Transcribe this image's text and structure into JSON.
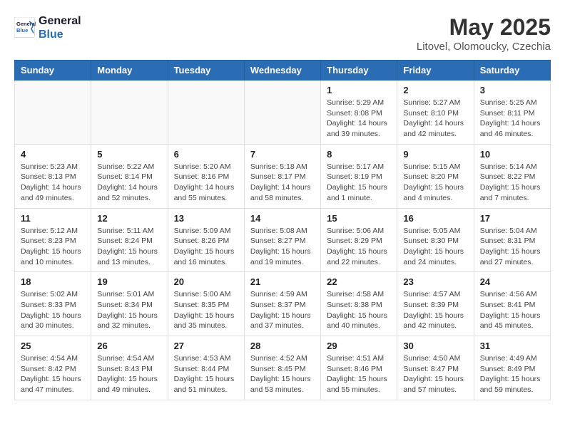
{
  "header": {
    "logo_general": "General",
    "logo_blue": "Blue",
    "month": "May 2025",
    "location": "Litovel, Olomoucky, Czechia"
  },
  "days_of_week": [
    "Sunday",
    "Monday",
    "Tuesday",
    "Wednesday",
    "Thursday",
    "Friday",
    "Saturday"
  ],
  "weeks": [
    [
      {
        "day": "",
        "info": ""
      },
      {
        "day": "",
        "info": ""
      },
      {
        "day": "",
        "info": ""
      },
      {
        "day": "",
        "info": ""
      },
      {
        "day": "1",
        "info": "Sunrise: 5:29 AM\nSunset: 8:08 PM\nDaylight: 14 hours\nand 39 minutes."
      },
      {
        "day": "2",
        "info": "Sunrise: 5:27 AM\nSunset: 8:10 PM\nDaylight: 14 hours\nand 42 minutes."
      },
      {
        "day": "3",
        "info": "Sunrise: 5:25 AM\nSunset: 8:11 PM\nDaylight: 14 hours\nand 46 minutes."
      }
    ],
    [
      {
        "day": "4",
        "info": "Sunrise: 5:23 AM\nSunset: 8:13 PM\nDaylight: 14 hours\nand 49 minutes."
      },
      {
        "day": "5",
        "info": "Sunrise: 5:22 AM\nSunset: 8:14 PM\nDaylight: 14 hours\nand 52 minutes."
      },
      {
        "day": "6",
        "info": "Sunrise: 5:20 AM\nSunset: 8:16 PM\nDaylight: 14 hours\nand 55 minutes."
      },
      {
        "day": "7",
        "info": "Sunrise: 5:18 AM\nSunset: 8:17 PM\nDaylight: 14 hours\nand 58 minutes."
      },
      {
        "day": "8",
        "info": "Sunrise: 5:17 AM\nSunset: 8:19 PM\nDaylight: 15 hours\nand 1 minute."
      },
      {
        "day": "9",
        "info": "Sunrise: 5:15 AM\nSunset: 8:20 PM\nDaylight: 15 hours\nand 4 minutes."
      },
      {
        "day": "10",
        "info": "Sunrise: 5:14 AM\nSunset: 8:22 PM\nDaylight: 15 hours\nand 7 minutes."
      }
    ],
    [
      {
        "day": "11",
        "info": "Sunrise: 5:12 AM\nSunset: 8:23 PM\nDaylight: 15 hours\nand 10 minutes."
      },
      {
        "day": "12",
        "info": "Sunrise: 5:11 AM\nSunset: 8:24 PM\nDaylight: 15 hours\nand 13 minutes."
      },
      {
        "day": "13",
        "info": "Sunrise: 5:09 AM\nSunset: 8:26 PM\nDaylight: 15 hours\nand 16 minutes."
      },
      {
        "day": "14",
        "info": "Sunrise: 5:08 AM\nSunset: 8:27 PM\nDaylight: 15 hours\nand 19 minutes."
      },
      {
        "day": "15",
        "info": "Sunrise: 5:06 AM\nSunset: 8:29 PM\nDaylight: 15 hours\nand 22 minutes."
      },
      {
        "day": "16",
        "info": "Sunrise: 5:05 AM\nSunset: 8:30 PM\nDaylight: 15 hours\nand 24 minutes."
      },
      {
        "day": "17",
        "info": "Sunrise: 5:04 AM\nSunset: 8:31 PM\nDaylight: 15 hours\nand 27 minutes."
      }
    ],
    [
      {
        "day": "18",
        "info": "Sunrise: 5:02 AM\nSunset: 8:33 PM\nDaylight: 15 hours\nand 30 minutes."
      },
      {
        "day": "19",
        "info": "Sunrise: 5:01 AM\nSunset: 8:34 PM\nDaylight: 15 hours\nand 32 minutes."
      },
      {
        "day": "20",
        "info": "Sunrise: 5:00 AM\nSunset: 8:35 PM\nDaylight: 15 hours\nand 35 minutes."
      },
      {
        "day": "21",
        "info": "Sunrise: 4:59 AM\nSunset: 8:37 PM\nDaylight: 15 hours\nand 37 minutes."
      },
      {
        "day": "22",
        "info": "Sunrise: 4:58 AM\nSunset: 8:38 PM\nDaylight: 15 hours\nand 40 minutes."
      },
      {
        "day": "23",
        "info": "Sunrise: 4:57 AM\nSunset: 8:39 PM\nDaylight: 15 hours\nand 42 minutes."
      },
      {
        "day": "24",
        "info": "Sunrise: 4:56 AM\nSunset: 8:41 PM\nDaylight: 15 hours\nand 45 minutes."
      }
    ],
    [
      {
        "day": "25",
        "info": "Sunrise: 4:54 AM\nSunset: 8:42 PM\nDaylight: 15 hours\nand 47 minutes."
      },
      {
        "day": "26",
        "info": "Sunrise: 4:54 AM\nSunset: 8:43 PM\nDaylight: 15 hours\nand 49 minutes."
      },
      {
        "day": "27",
        "info": "Sunrise: 4:53 AM\nSunset: 8:44 PM\nDaylight: 15 hours\nand 51 minutes."
      },
      {
        "day": "28",
        "info": "Sunrise: 4:52 AM\nSunset: 8:45 PM\nDaylight: 15 hours\nand 53 minutes."
      },
      {
        "day": "29",
        "info": "Sunrise: 4:51 AM\nSunset: 8:46 PM\nDaylight: 15 hours\nand 55 minutes."
      },
      {
        "day": "30",
        "info": "Sunrise: 4:50 AM\nSunset: 8:47 PM\nDaylight: 15 hours\nand 57 minutes."
      },
      {
        "day": "31",
        "info": "Sunrise: 4:49 AM\nSunset: 8:49 PM\nDaylight: 15 hours\nand 59 minutes."
      }
    ]
  ]
}
